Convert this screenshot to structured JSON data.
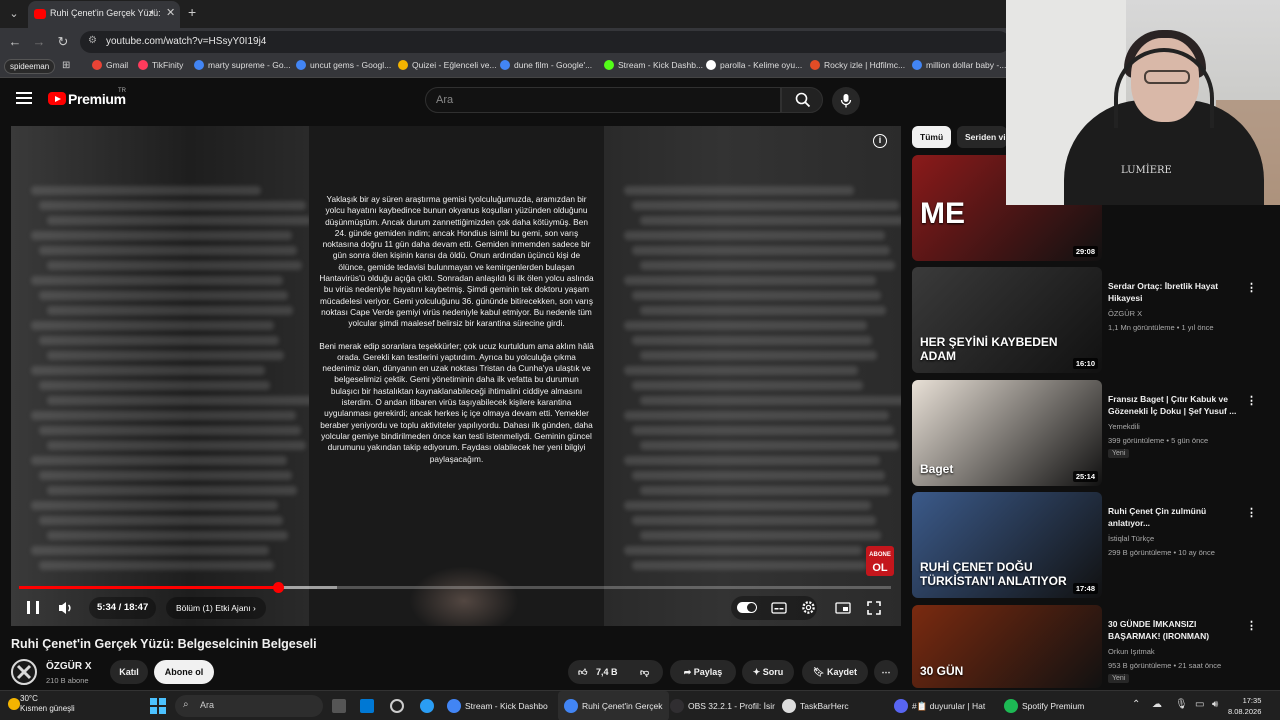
{
  "browser": {
    "tab_title": "Ruhi Çenet'in Gerçek Yüzü:",
    "url": "youtube.com/watch?v=HSsyY0I19j4",
    "profile": "spideeman",
    "bookmarks": [
      {
        "label": "Gmail",
        "color": "#ea4335"
      },
      {
        "label": "TikFinity",
        "color": "#ff3b5c"
      },
      {
        "label": "marty supreme - Go...",
        "color": "#4285f4"
      },
      {
        "label": "uncut gems - Googl...",
        "color": "#4285f4"
      },
      {
        "label": "Quizei - Eğlenceli ve...",
        "color": "#f4b400"
      },
      {
        "label": "dune film - Google'...",
        "color": "#4285f4"
      },
      {
        "label": "Stream - Kick Dashb...",
        "color": "#53fc18"
      },
      {
        "label": "parolla - Kelime oyu...",
        "color": "#ffffff"
      },
      {
        "label": "Rocky izle | Hdfilmc...",
        "color": "#e34c26"
      },
      {
        "label": "million dollar baby -...",
        "color": "#4285f4"
      }
    ]
  },
  "youtube": {
    "brand": "Premium",
    "brand_region": "TR",
    "search_placeholder": "Ara"
  },
  "player": {
    "caption_paragraphs": [
      "Yaklaşık bir ay süren araştırma gemisi tyolculuğumuzda, aramızdan bir yolcu hayatını kaybedince bunun okyanus koşulları yüzünden olduğunu düşünmüştüm. Ancak durum zannettiğimizden çok daha kötüymüş. Ben 24. günde gemiden indim; ancak Hondius isimli bu gemi, son varış noktasına doğru 11 gün daha devam etti. Gemiden inmemden sadece bir gün sonra ölen kişinin karısı da öldü. Onun ardından üçüncü kişi de ölünce, gemide tedavisi bulunmayan ve kemirgenlerden bulaşan Hantavirüs'ü olduğu açığa çıktı. Sonradan anlaşıldı ki ilk ölen yolcu aslında bu virüs nedeniyle hayatını kaybetmiş. Şimdi geminin tek doktoru yaşam mücadelesi veriyor. Gemi yolculuğunu 36. gününde bitirecekken, son varış noktası Cape Verde gemiyi virüs nedeniyle kabul etmiyor. Bu nedenle tüm yolcular şimdi maalesef belirsiz bir karantina sürecine girdi.",
      "Beni merak edip soranlara teşekkürler; çok ucuz kurtuldum ama aklım hâlâ orada. Gerekli kan testlerini yaptırdım. Ayrıca bu yolculuğa çıkma nedenimiz olan, dünyanın en uzak noktası Tristan da Cunha'ya ulaştık ve belgeselimizi çektik. Gemi yönetiminin daha ilk vefatta bu durumun bulaşıcı bir hastalıktan kaynaklanabileceği ihtimalini ciddiye almasını isterdim. O andan itibaren virüs taşıyabilecek kişilere karantina uygulanması gerekirdi; ancak herkes iç içe olmaya devam etti. Yemekler beraber yeniyordu ve toplu aktiviteler yapılıyordu. Dahası ilk günden, daha yolcular gemiye bindirilmeden önce kan testi istenmeliydi. Geminin güncel durumunu yakından takip ediyorum. Faydası olabilecek her yeni bilgiyi paylaşacağım."
    ],
    "subscribe_badge": [
      "ABONE",
      "OL"
    ],
    "time": "5:34 / 18:47",
    "progress_fraction": 0.2965,
    "buffered_fraction": 0.365,
    "chapter": "Bölüm (1) Etki Ajanı",
    "chapter_arrow": "›"
  },
  "video": {
    "title": "Ruhi Çenet'in Gerçek Yüzü: Belgeselcinin Belgeseli",
    "channel": "ÖZGÜR X",
    "subscribers": "210 B abone",
    "join": "Katıl",
    "subscribe": "Abone ol",
    "likes": "7,4 B",
    "share": "Paylaş",
    "ask": "Soru",
    "save": "Kaydet"
  },
  "sidebar": {
    "chips": [
      "Tümü",
      "Seriden vi"
    ],
    "items": [
      {
        "title": "",
        "channel": "",
        "meta": "",
        "duration": "29:08",
        "thumb_color": "#8b1a1a",
        "thumb_text": "ME"
      },
      {
        "title": "Serdar Ortaç: İbretlik Hayat Hikayesi",
        "channel": "ÖZGÜR X",
        "meta": "1,1 Mn görüntüleme • 1 yıl önce",
        "duration": "16:10",
        "thumb_color": "#3a3a3a",
        "thumb_text": "HER ŞEYİNİ KAYBEDEN ADAM"
      },
      {
        "title": "Fransız Baget | Çıtır Kabuk ve Gözenekli İç Doku | Şef Yusuf ...",
        "channel": "Yemekdili",
        "meta": "399 görüntüleme • 5 gün önce",
        "duration": "25:14",
        "thumb_color": "#e8e0d6",
        "thumb_text": "Baget",
        "new": "Yeni"
      },
      {
        "title": "Ruhi Çenet Çin zulmünü anlatıyor...",
        "channel": "İstiqlal Türkçe",
        "meta": "299 B görüntüleme • 10 ay önce",
        "duration": "17:48",
        "thumb_color": "#3b5a8a",
        "thumb_text": "RUHİ ÇENET DOĞU TÜRKİSTAN'I ANLATIYOR"
      },
      {
        "title": "30 GÜNDE İMKANSIZI BAŞARMAK! (IRONMAN)",
        "channel": "Orkun Işıtmak",
        "meta": "953 B görüntüleme • 21 saat önce",
        "duration": "",
        "thumb_color": "#7a2a10",
        "thumb_text": "30 GÜN",
        "new": "Yeni"
      }
    ]
  },
  "webcam": {
    "shirt_print": "LUMİERE"
  },
  "taskbar": {
    "weather_temp": "30°C",
    "weather_desc": "Kısmen güneşli",
    "search": "Ara",
    "apps": [
      {
        "label": "Stream - Kick Dashbo",
        "color": "#4285f4"
      },
      {
        "label": "Ruhi Çenet'in Gerçek",
        "color": "#4285f4",
        "active": true
      },
      {
        "label": "OBS 32.2.1 - Profil: İsir",
        "color": "#302e31"
      },
      {
        "label": "TaskBarHerc",
        "color": "#ddd"
      },
      {
        "label": "#📋 duyurular | Hat",
        "color": "#5865f2"
      },
      {
        "label": "Spotify Premium",
        "color": "#1db954"
      }
    ],
    "time": "17:35",
    "date": "8.08.2026"
  }
}
